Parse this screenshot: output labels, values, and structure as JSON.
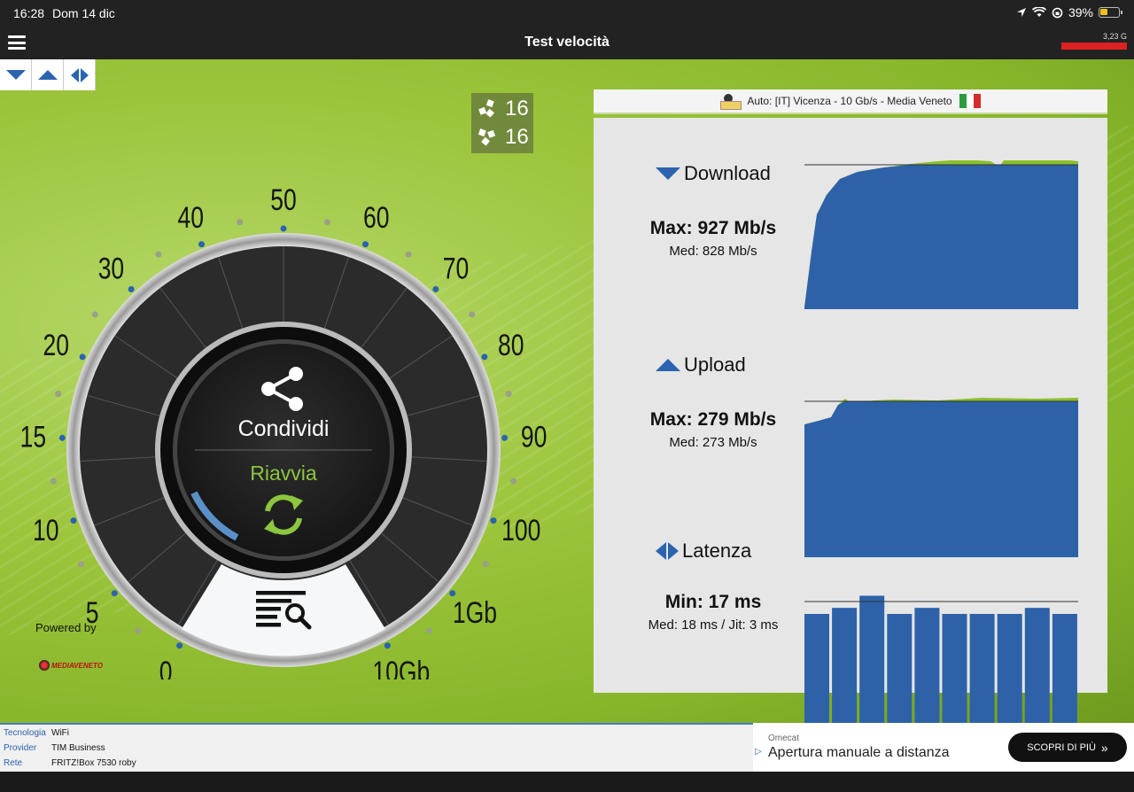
{
  "status_bar": {
    "time": "16:28",
    "date": "Dom 14 dic",
    "battery_percent": "39%"
  },
  "app_bar": {
    "title": "Test velocità",
    "data_usage": "3,23 G"
  },
  "threads": {
    "download_threads": "16",
    "upload_threads": "16"
  },
  "gauge": {
    "scale_labels": [
      "0",
      "5",
      "10",
      "15",
      "20",
      "30",
      "40",
      "50",
      "60",
      "70",
      "80",
      "90",
      "100",
      "1Gb",
      "10Gb"
    ],
    "share_label": "Condividi",
    "restart_label": "Riavvia",
    "progress_fraction": 0.12
  },
  "powered_by": {
    "label": "Powered by",
    "logo_text": "MEDIAVENETO"
  },
  "server": {
    "label": "Auto: [IT] Vicenza - 10 Gb/s - Media Veneto",
    "flag_colors": [
      "#2e9a3e",
      "#ffffff",
      "#d52b2b"
    ]
  },
  "download": {
    "title": "Download",
    "max": "Max: 927 Mb/s",
    "med": "Med: 828 Mb/s"
  },
  "upload": {
    "title": "Upload",
    "max": "Max: 279 Mb/s",
    "med": "Med: 273 Mb/s"
  },
  "latency": {
    "title": "Latenza",
    "min": "Min: 17 ms",
    "med": "Med: 18 ms / Jit: 3 ms",
    "bars_ms": [
      18,
      19,
      21,
      18,
      19,
      18,
      18,
      18,
      19,
      18
    ]
  },
  "info": {
    "rows": [
      {
        "key": "Tecnologia",
        "value": "WiFi"
      },
      {
        "key": "Provider",
        "value": "TIM Business"
      },
      {
        "key": "Rete",
        "value": "FRITZ!Box 7530 roby"
      }
    ]
  },
  "ad": {
    "brand": "Omecat",
    "title": "Apertura manuale a distanza",
    "button_label": "SCOPRI DI PIÙ"
  },
  "colors": {
    "accent_blue": "#2b63b0",
    "chart_green": "#8cbf2c",
    "restart_green": "#8cc63f",
    "usage_red": "#d22222"
  }
}
